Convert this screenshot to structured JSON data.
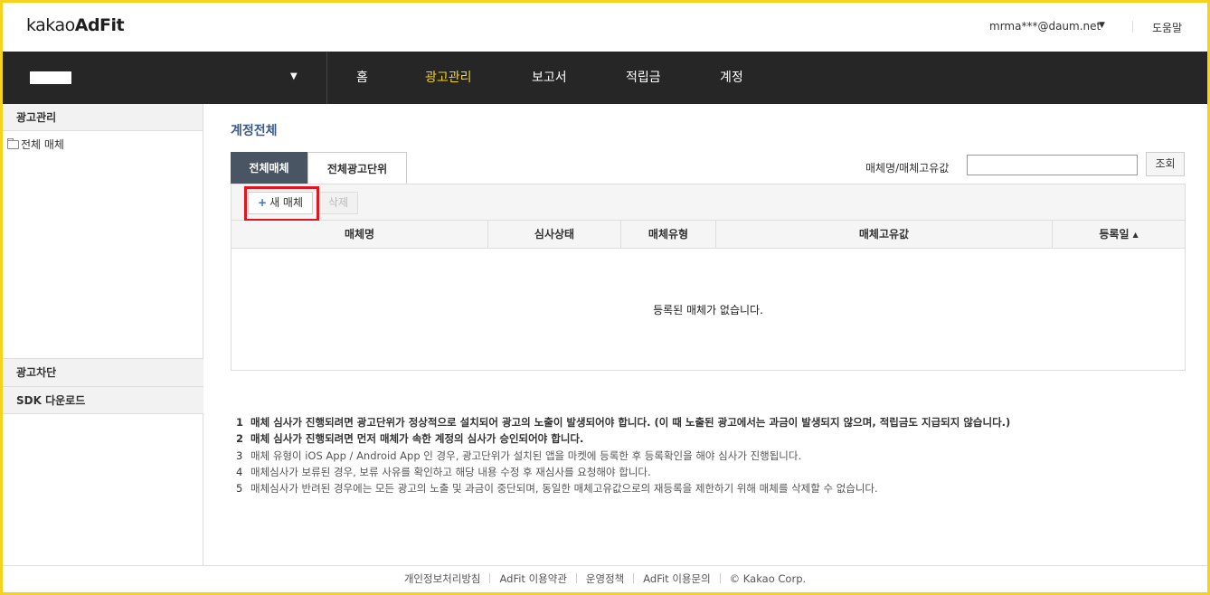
{
  "header": {
    "logo_prefix": "kakao",
    "logo_suffix": "AdFit",
    "account_email": "mrma***@daum.net",
    "help_label": "도움말"
  },
  "nav": {
    "menu": [
      "홈",
      "광고관리",
      "보고서",
      "적립금",
      "계정"
    ],
    "active_index": 1
  },
  "sidebar": {
    "section_title": "광고관리",
    "tree_item": "전체 매체",
    "items": [
      "광고차단",
      "SDK 다운로드"
    ]
  },
  "main": {
    "page_title": "계정전체",
    "tabs": [
      "전체매체",
      "전체광고단위"
    ],
    "search": {
      "label": "매체명/매체고유값",
      "value": "",
      "button": "조회"
    },
    "toolbar": {
      "new_button": "새 매체",
      "delete_button": "삭제"
    },
    "table": {
      "columns": [
        "매체명",
        "심사상태",
        "매체유형",
        "매체고유값",
        "등록일"
      ],
      "sort_indicator": "▲",
      "empty_message": "등록된 매체가 없습니다."
    },
    "notes": [
      "매체 심사가 진행되려면 광고단위가 정상적으로 설치되어 광고의 노출이 발생되어야 합니다. (이 때 노출된 광고에서는 과금이 발생되지 않으며, 적립금도 지급되지 않습니다.)",
      "매체 심사가 진행되려면 먼저 매체가 속한 계정의 심사가 승인되어야 합니다.",
      "매체 유형이 iOS App / Android App 인 경우, 광고단위가 설치된 앱을 마켓에 등록한 후 등록확인을 해야 심사가 진행됩니다.",
      "매체심사가 보류된 경우, 보류 사유를 확인하고 해당 내용 수정 후 재심사를 요청해야 합니다.",
      "매체심사가 반려된 경우에는 모든 광고의 노출 및 과금이 중단되며, 동일한 매체고유값으로의 재등록을 제한하기 위해 매체를 삭제할 수 없습니다."
    ]
  },
  "footer": {
    "links": [
      "개인정보처리방침",
      "AdFit 이용약관",
      "운영정책",
      "AdFit 이용문의"
    ],
    "copyright": "© Kakao Corp."
  },
  "colors": {
    "brand_yellow": "#f7d21c",
    "nav_bg": "#262626",
    "highlight_red": "#e3141d",
    "title_blue": "#3a5a8c"
  },
  "icons": {
    "account_caret": "caret-down-icon",
    "folder": "folder-icon",
    "plus": "plus-icon",
    "sort": "sort-asc-icon"
  }
}
